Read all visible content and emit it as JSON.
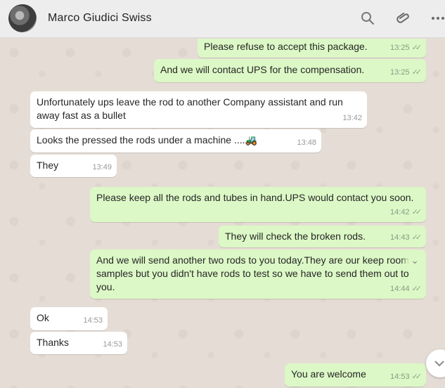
{
  "header": {
    "contact_name": "Marco Giudici Swiss",
    "icons": [
      "search-icon",
      "attach-icon",
      "menu-icon"
    ]
  },
  "messages": [
    {
      "dir": "out",
      "text": "Please refuse to accept this package.",
      "time": "13:25",
      "ticks": "✓✓"
    },
    {
      "dir": "out",
      "text": "And we will contact UPS for the compensation.",
      "time": "13:25",
      "ticks": "✓✓"
    },
    {
      "dir": "in",
      "text": "Unfortunately ups leave the rod to another Company assistant and run away fast as a bullet",
      "time": "13:42"
    },
    {
      "dir": "in",
      "text": "Looks the pressed the rods under a machine ....🚜",
      "time": "13:48"
    },
    {
      "dir": "in",
      "text": "They",
      "time": "13:49"
    },
    {
      "dir": "out",
      "text": "Please keep all the rods and tubes in hand.UPS would contact you soon.",
      "time": "14:42",
      "ticks": "✓✓"
    },
    {
      "dir": "out",
      "text": "They will check the broken rods.",
      "time": "14:43",
      "ticks": "✓✓"
    },
    {
      "dir": "out",
      "text": "And we will send another two rods to you today.They are our keep room samples but you didn't have rods to test so we have to send them out to you.",
      "time": "14:44",
      "ticks": "✓✓"
    },
    {
      "dir": "in",
      "text": "Ok",
      "time": "14:53"
    },
    {
      "dir": "in",
      "text": "Thanks",
      "time": "14:53"
    },
    {
      "dir": "out",
      "text": "You are welcome",
      "time": "14:53",
      "ticks": "✓✓"
    }
  ],
  "colors": {
    "outgoing_bubble": "#dcf8c6",
    "incoming_bubble": "#ffffff",
    "chat_background": "#e5ddd5",
    "header_background": "#ededed"
  }
}
